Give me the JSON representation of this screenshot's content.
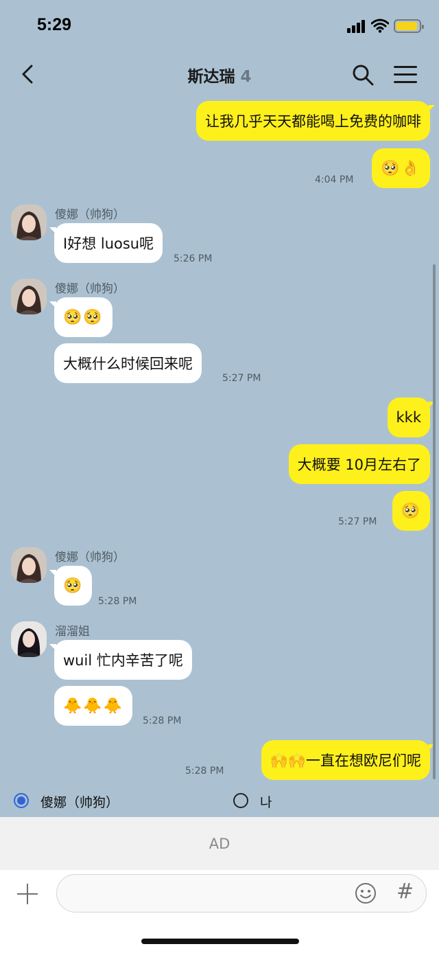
{
  "status_bar": {
    "time": "5:29"
  },
  "header": {
    "title": "斯达瑞",
    "member_count": "4"
  },
  "messages": [
    {
      "text": "让我几乎天天都能喝上免费的咖啡"
    },
    {
      "text": "🥺👌",
      "time": "4:04 PM"
    },
    {
      "sender": "傻娜（帅狗）",
      "text": "I好想 luosu呢",
      "time": "5:26 PM"
    },
    {
      "sender": "傻娜（帅狗）",
      "text": "🥺🥺"
    },
    {
      "text": "大概什么时候回来呢",
      "time": "5:27 PM"
    },
    {
      "text": "kkk"
    },
    {
      "text": "大概要 10月左右了"
    },
    {
      "text": "🥺",
      "time": "5:27 PM"
    },
    {
      "sender": "傻娜（帅狗）",
      "text": "🥺",
      "time": "5:28 PM"
    },
    {
      "sender": "溜溜姐",
      "text": "wuil 忙内辛苦了呢"
    },
    {
      "text": "🐥🐥🐥",
      "time": "5:28 PM"
    },
    {
      "text": "🙌🙌一直在想欧尼们呢",
      "time": "5:28 PM"
    }
  ],
  "poll": {
    "options": [
      {
        "label": "傻娜（帅狗）",
        "selected": true
      },
      {
        "label": "나",
        "selected": false
      }
    ]
  },
  "ad": {
    "label": "AD"
  },
  "input": {
    "placeholder": ""
  },
  "icons": {
    "back": "chevron-left-icon",
    "search": "search-icon",
    "menu": "hamburger-menu-icon",
    "attach": "plus-icon",
    "emoji": "smiley-icon",
    "hashtag": "hash-icon"
  },
  "colors": {
    "background": "#abc1d1",
    "outgoing_bubble": "#fef01b",
    "incoming_bubble": "#ffffff",
    "radio_selected": "#2f64d8"
  }
}
